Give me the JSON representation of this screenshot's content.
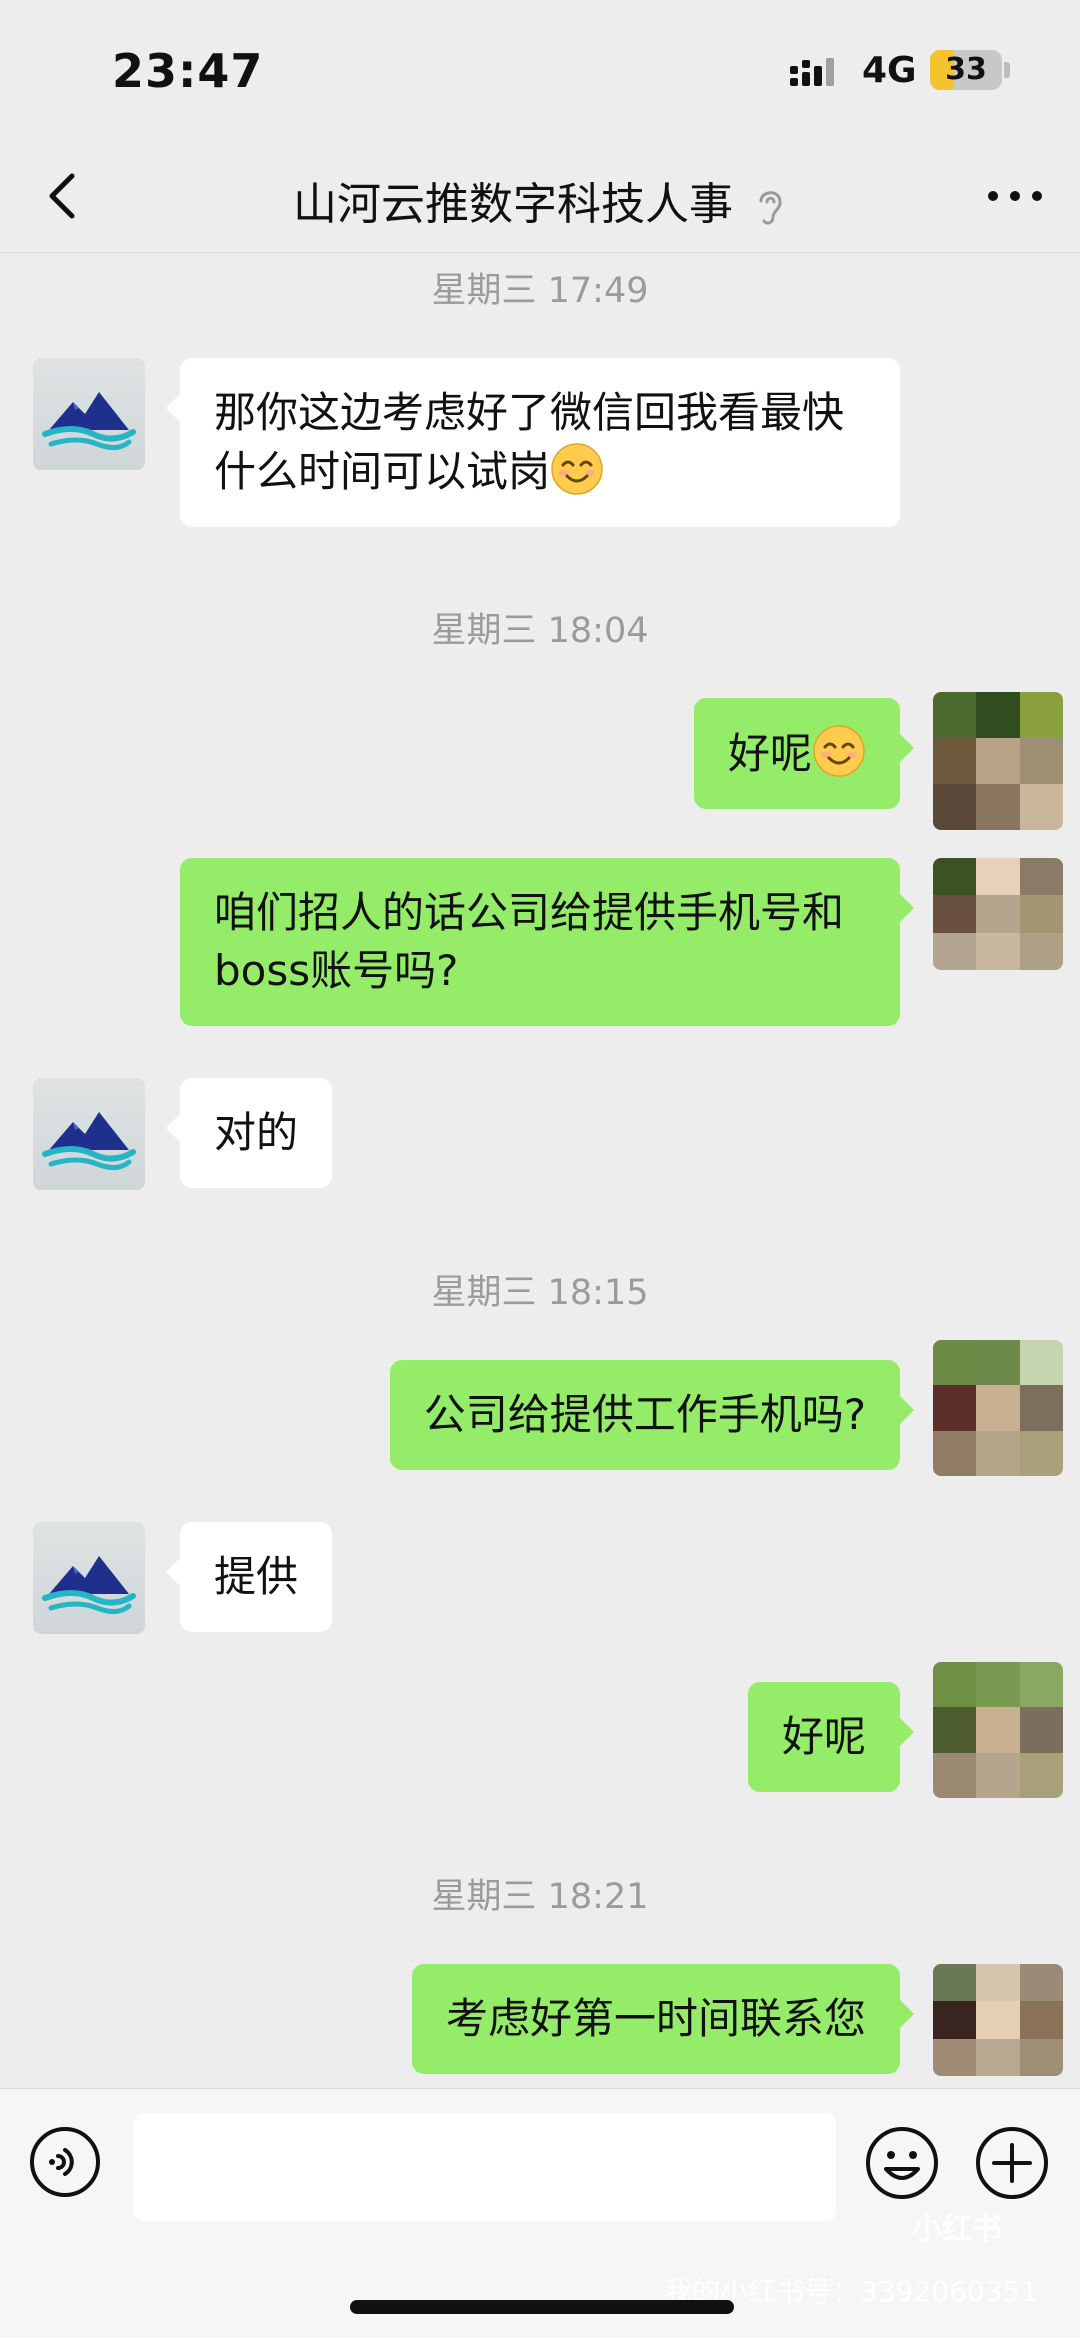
{
  "status_bar": {
    "time": "23:47",
    "network": "4G",
    "battery": "33",
    "battery_level": 0.33
  },
  "header": {
    "title": "山河云推数字科技人事"
  },
  "messages": [
    {
      "type": "timestamp",
      "text": "星期三 17:49"
    },
    {
      "type": "received",
      "text": "那你这边考虑好了微信回我看最快什么时间可以试岗",
      "emoji": "smiling-face"
    },
    {
      "type": "timestamp",
      "text": "星期三 18:04"
    },
    {
      "type": "sent",
      "text": "好呢",
      "emoji": "smiling-face"
    },
    {
      "type": "sent",
      "text": "咱们招人的话公司给提供手机号和boss账号吗?"
    },
    {
      "type": "received",
      "text": "对的"
    },
    {
      "type": "timestamp",
      "text": "星期三 18:15"
    },
    {
      "type": "sent",
      "text": "公司给提供工作手机吗?"
    },
    {
      "type": "received",
      "text": "提供"
    },
    {
      "type": "sent",
      "text": "好呢"
    },
    {
      "type": "timestamp",
      "text": "星期三 18:21"
    },
    {
      "type": "sent",
      "text": "考虑好第一时间联系您"
    }
  ],
  "input_bar": {
    "text": ""
  },
  "watermark": {
    "logo": "小红书",
    "id_text": "我的小红书号：3392060351"
  },
  "colors": {
    "background": "#ededed",
    "sent_bubble": "#95ec69",
    "received_bubble": "#ffffff",
    "timestamp": "#9b9b9b"
  },
  "icons": [
    "back-icon",
    "ear-icon",
    "more-icon",
    "voice-icon",
    "emoji-icon",
    "plus-icon"
  ]
}
